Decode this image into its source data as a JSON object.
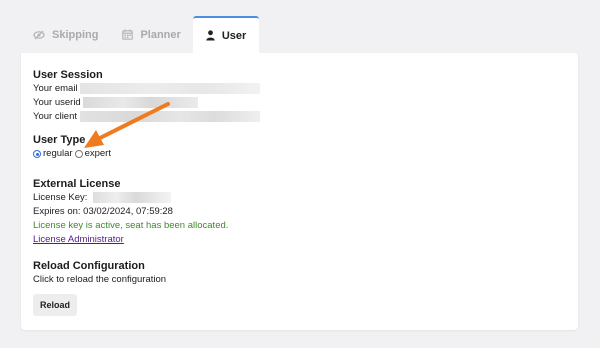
{
  "tabs": [
    {
      "label": "Skipping",
      "icon": "eye-slash-icon",
      "active": false
    },
    {
      "label": "Planner",
      "icon": "calendar-icon",
      "active": false
    },
    {
      "label": "User",
      "icon": "user-icon",
      "active": true
    }
  ],
  "session": {
    "title": "User Session",
    "email_label": "Your email",
    "userid_label": "Your userid",
    "client_label": "Your client"
  },
  "user_type": {
    "title": "User Type",
    "options": [
      {
        "label": "regular",
        "checked": true
      },
      {
        "label": "expert",
        "checked": false
      }
    ]
  },
  "license": {
    "title": "External License",
    "key_label": "License Key:",
    "expires": "Expires on: 03/02/2024, 07:59:28",
    "status": "License key is active, seat has been allocated.",
    "admin_link": "License Administrator"
  },
  "reload": {
    "title": "Reload Configuration",
    "description": "Click to reload the configuration",
    "button": "Reload"
  },
  "colors": {
    "tab_accent": "#4a90e2",
    "status_green": "#3f8a2c",
    "annotation_arrow": "#f07a1e",
    "link": "#551a8b"
  }
}
